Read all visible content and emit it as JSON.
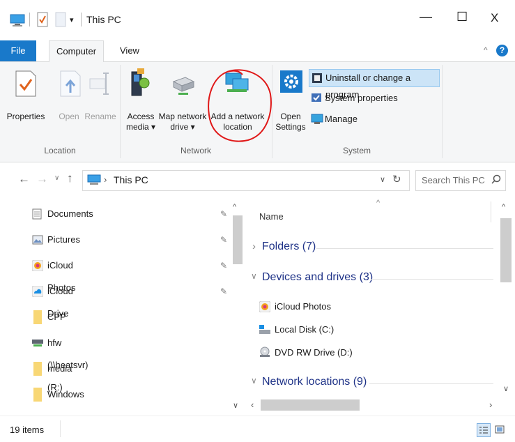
{
  "window": {
    "title": "This PC",
    "controls": {
      "minimize": "—",
      "maximize": "☐",
      "close": "X"
    }
  },
  "ribbon": {
    "tabs": [
      "File",
      "Computer",
      "View"
    ],
    "groups": {
      "location": {
        "label": "Location",
        "buttons": [
          "Properties",
          "Open",
          "Rename"
        ]
      },
      "network": {
        "label": "Network",
        "buttons": [
          {
            "line1": "Access",
            "line2": "media ▾"
          },
          {
            "line1": "Map network",
            "line2": "drive ▾"
          },
          {
            "line1": "Add a network",
            "line2": "location"
          }
        ]
      },
      "system": {
        "label": "System",
        "open_settings": {
          "line1": "Open",
          "line2": "Settings"
        },
        "items": [
          "Uninstall or change a program",
          "System properties",
          "Manage"
        ]
      }
    }
  },
  "address": {
    "path_label": "This PC",
    "search_placeholder": "Search This PC"
  },
  "nav_pane": {
    "items": [
      {
        "label": "Documents",
        "icon": "documents-icon",
        "pinned": true
      },
      {
        "label": "Pictures",
        "icon": "pictures-icon",
        "pinned": true
      },
      {
        "label": "iCloud Photos",
        "icon": "icloud-photos-icon",
        "pinned": true
      },
      {
        "label": "iCloud Drive",
        "icon": "icloud-drive-icon",
        "pinned": true
      },
      {
        "label": "CPP",
        "icon": "folder-icon",
        "pinned": false
      },
      {
        "label": "hfw (\\\\heatsvr) (R:)",
        "icon": "network-drive-icon",
        "pinned": false
      },
      {
        "label": "media",
        "icon": "folder-icon",
        "pinned": false
      },
      {
        "label": "Windows",
        "icon": "folder-icon",
        "pinned": false
      }
    ]
  },
  "content": {
    "column_header": "Name",
    "sections": [
      {
        "label": "Folders (7)",
        "expanded": false
      },
      {
        "label": "Devices and drives (3)",
        "expanded": true
      },
      {
        "label": "Network locations (9)",
        "expanded": true
      }
    ],
    "devices": [
      "iCloud Photos",
      "Local Disk (C:)",
      "DVD RW Drive (D:)"
    ]
  },
  "status": {
    "items_count": "19 items"
  },
  "colors": {
    "accent": "#1979ca",
    "annotation": "#e01818",
    "folder": "#f8d775"
  }
}
